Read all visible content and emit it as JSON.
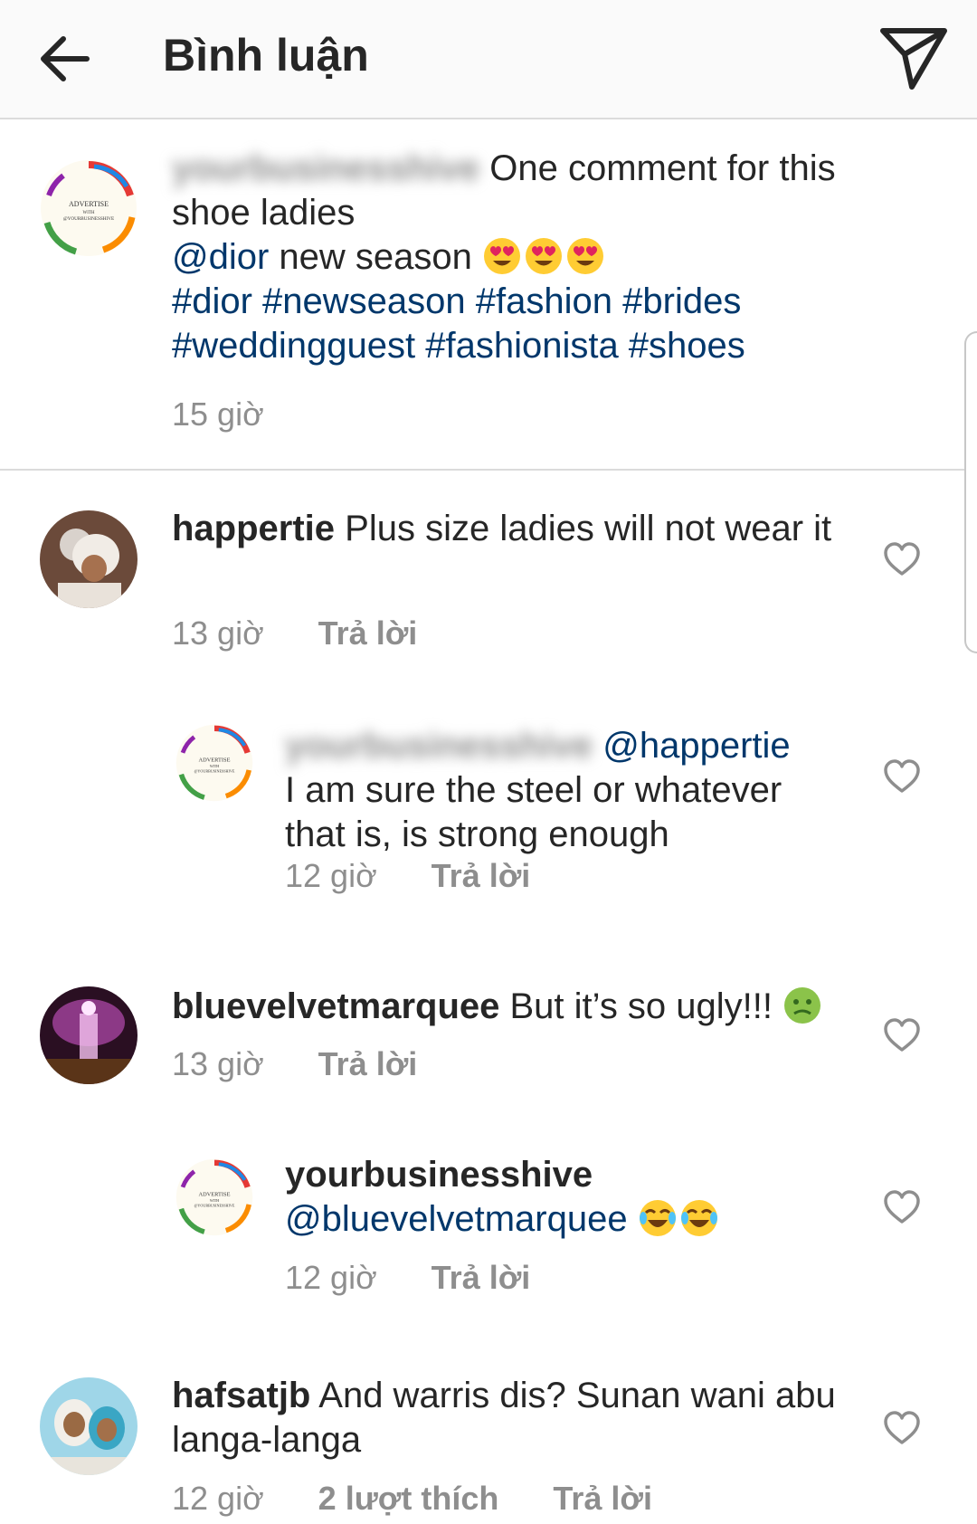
{
  "header": {
    "title": "Bình luận",
    "back_icon": "arrow-left-icon",
    "send_icon": "paper-plane-icon"
  },
  "caption": {
    "username_blurred": "yourbusinesshive",
    "text_1": " One comment for this shoe ladies",
    "mention": "@dior",
    "text_2": " new season ",
    "hashtags": "#dior #newseason #fashion #brides #weddingguest #fashionista #shoes",
    "time": "15 giờ",
    "avatar_text": {
      "line1": "ADVERTISE",
      "line2": "WITH",
      "line3": "@YOURBUSINESSHIVE"
    }
  },
  "comments": [
    {
      "username": "happertie",
      "text": " Plus size ladies will not wear it",
      "time": "13 giờ",
      "reply_label": "Trả lời"
    },
    {
      "username_blurred": "yourbusinesshive",
      "mention": "@happertie",
      "text": "I am sure the steel or whatever that is, is strong enough",
      "time": "12 giờ",
      "reply_label": "Trả lời"
    },
    {
      "username": "bluevelvetmarquee",
      "text": " But it’s so ugly!!! ",
      "time": "13 giờ",
      "reply_label": "Trả lời"
    },
    {
      "username": "yourbusinesshive",
      "mention": "@bluevelvetmarquee",
      "time": "12 giờ",
      "reply_label": "Trả lời"
    },
    {
      "username": "hafsatjb",
      "text": " And warris dis? Sunan wani abu langa-langa",
      "time": "12 giờ",
      "likes": "2 lượt thích",
      "reply_label": "Trả lời"
    }
  ],
  "colors": {
    "text": "#262626",
    "secondary": "#8e8e8e",
    "link": "#00376b",
    "divider": "#dbdbdb",
    "header_bg": "#fafafa"
  }
}
